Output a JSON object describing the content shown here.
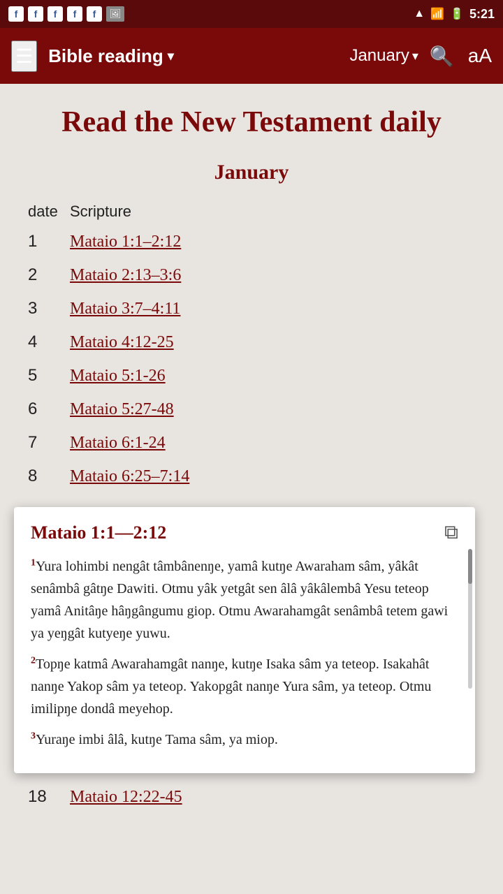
{
  "statusBar": {
    "time": "5:21",
    "fbIcons": [
      "f",
      "f",
      "f",
      "f",
      "f"
    ],
    "photoIcon": "🖼"
  },
  "navBar": {
    "hamburgerLabel": "☰",
    "title": "Bible reading",
    "titleArrow": "▾",
    "month": "January",
    "monthArrow": "▾",
    "searchIcon": "🔍",
    "fontSizeIcon": "aA"
  },
  "page": {
    "title": "Read the New Testament daily",
    "monthHeading": "January",
    "tableHeaders": {
      "date": "date",
      "scripture": "Scripture"
    },
    "rows": [
      {
        "day": "1",
        "scripture": "Mataio 1:1–2:12"
      },
      {
        "day": "2",
        "scripture": "Mataio 2:13–3:6"
      },
      {
        "day": "3",
        "scripture": "Mataio 3:7–4:11"
      },
      {
        "day": "4",
        "scripture": "Mataio 4:12-25"
      },
      {
        "day": "5",
        "scripture": "Mataio 5:1-26"
      },
      {
        "day": "6",
        "scripture": "Mataio 5:27-48"
      },
      {
        "day": "7",
        "scripture": "Mataio 6:1-24"
      },
      {
        "day": "8",
        "scripture": "Mataio 6:25–7:14"
      }
    ],
    "bottomRow": {
      "day": "18",
      "scripture": "Mataio 12:22-45"
    }
  },
  "popup": {
    "title": "Mataio 1:1—2:12",
    "externalLinkIcon": "⧉",
    "verses": [
      {
        "num": "1",
        "text": "Yura lohimbi nengât tâmbânenŋe, yamâ kutŋe Awaraham sâm, yâkât senâmbâ gâtŋe Dawiti. Otmu yâk yetgât sen âlâ yâkâlembâ Yesu teteop yamâ Anitâŋe hâŋgângumu giop. Otmu Awarahamgât senâmbâ tetem gawi ya yeŋgât kutyeŋe yuwu."
      },
      {
        "num": "2",
        "text": "Topŋe katmâ Awarahamgât nanŋe, kutŋe Isaka sâm ya teteop. Isakahât nanŋe Yakop sâm ya teteop. Yakopgât nanŋe Yura sâm, ya teteop. Otmu imilipŋe dondâ meyehop."
      },
      {
        "num": "3",
        "text": "Yuraŋe imbi âlâ, kutŋe Tama sâm, ya miop."
      }
    ]
  }
}
